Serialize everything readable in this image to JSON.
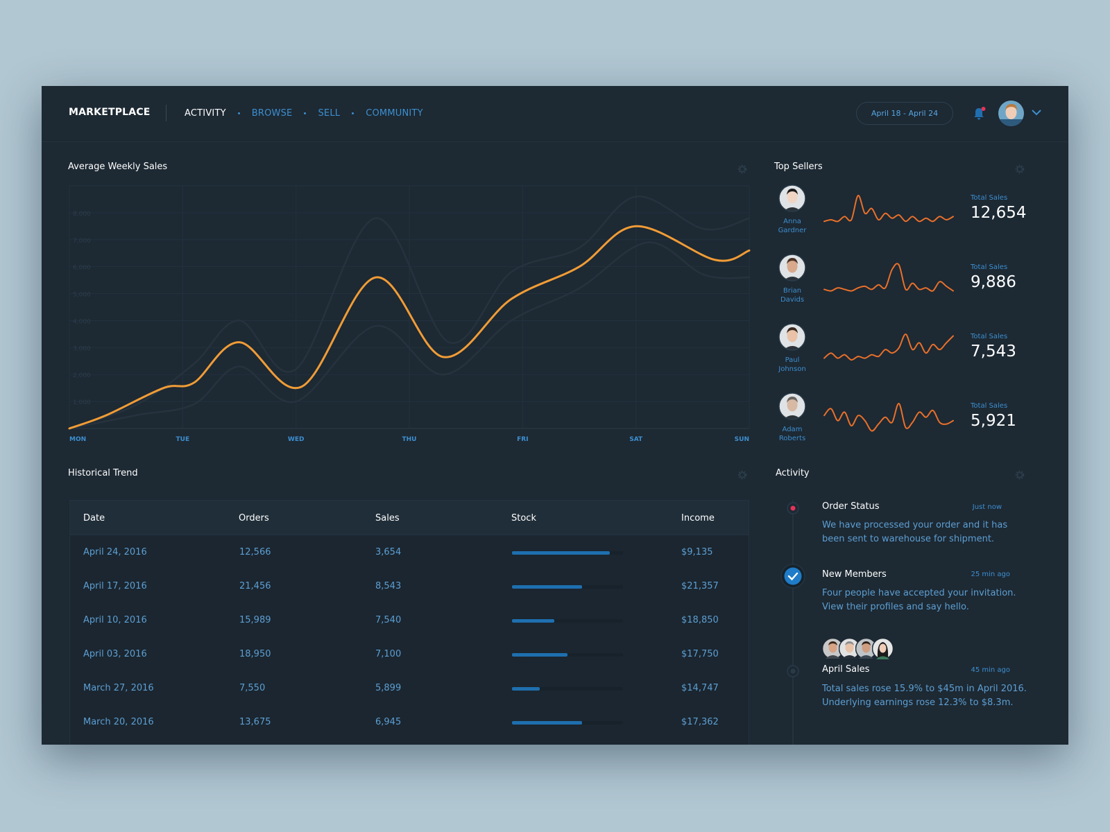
{
  "header": {
    "brand": "MARKETPLACE",
    "nav": [
      {
        "label": "ACTIVITY",
        "active": true
      },
      {
        "label": "BROWSE",
        "active": false
      },
      {
        "label": "SELL",
        "active": false
      },
      {
        "label": "COMMUNITY",
        "active": false
      }
    ],
    "date_range": "April 18 - April 24",
    "icons": {
      "notification": "bell-icon",
      "account": "chevron-down-icon"
    },
    "notification_dot_color": "#e8335a"
  },
  "sales_panel": {
    "title": "Average Weekly Sales",
    "settings_icon": "gear-icon"
  },
  "chart_data": {
    "type": "line",
    "title": "Average Weekly Sales",
    "xlabel": "",
    "ylabel": "",
    "x_ticks": [
      "MON",
      "TUE",
      "WED",
      "THU",
      "FRI",
      "SAT",
      "SUN"
    ],
    "y_ticks": [
      "1,000",
      "2,000",
      "3,000",
      "4,000",
      "5,000",
      "6,000",
      "7,000",
      "8,000"
    ],
    "ylim": [
      0,
      9000
    ],
    "grid": true,
    "series": [
      {
        "color": "#f19c36",
        "points": [
          [
            0,
            0
          ],
          [
            0.33,
            500
          ],
          [
            0.83,
            1500
          ],
          [
            1.1,
            1700
          ],
          [
            1.5,
            3200
          ],
          [
            2.05,
            1550
          ],
          [
            2.7,
            5600
          ],
          [
            3.3,
            2650
          ],
          [
            3.9,
            4800
          ],
          [
            4.5,
            6000
          ],
          [
            5.0,
            7500
          ],
          [
            5.7,
            6250
          ],
          [
            6.0,
            6600
          ]
        ]
      },
      {
        "color": "#26333e",
        "points": [
          [
            0,
            0
          ],
          [
            0.6,
            900
          ],
          [
            1.1,
            2400
          ],
          [
            1.5,
            4000
          ],
          [
            2.0,
            2200
          ],
          [
            2.7,
            7800
          ],
          [
            3.35,
            3200
          ],
          [
            3.9,
            5800
          ],
          [
            4.5,
            6700
          ],
          [
            5.0,
            8600
          ],
          [
            5.6,
            7400
          ],
          [
            6.0,
            7800
          ]
        ]
      },
      {
        "color": "#26333e",
        "points": [
          [
            0,
            0
          ],
          [
            0.6,
            500
          ],
          [
            1.1,
            900
          ],
          [
            1.5,
            2300
          ],
          [
            2.0,
            1000
          ],
          [
            2.7,
            3800
          ],
          [
            3.3,
            2000
          ],
          [
            3.9,
            4000
          ],
          [
            4.5,
            5200
          ],
          [
            5.1,
            6900
          ],
          [
            5.6,
            5700
          ],
          [
            6.0,
            5600
          ]
        ]
      }
    ]
  },
  "sellers_panel": {
    "title": "Top Sellers",
    "settings_icon": "gear-icon",
    "total_label": "Total Sales",
    "sellers": [
      {
        "first": "Anna",
        "last": "Gardner",
        "total": "12,654",
        "spark": [
          2,
          3,
          2,
          5,
          3,
          18,
          7,
          10,
          3,
          7,
          4,
          6,
          2,
          5,
          2,
          4,
          2,
          5,
          3,
          5
        ],
        "avatar_hair": "#1b1b1b",
        "avatar_skin": "#f1d5c4"
      },
      {
        "first": "Brian",
        "last": "Davids",
        "total": "9,886",
        "spark": [
          3,
          2,
          4,
          3,
          2,
          4,
          5,
          3,
          6,
          4,
          16,
          19,
          3,
          7,
          3,
          4,
          2,
          8,
          5,
          2
        ],
        "avatar_hair": "#4a3325",
        "avatar_skin": "#d9a98c"
      },
      {
        "first": "Paul",
        "last": "Johnson",
        "total": "7,543",
        "spark": [
          3,
          6,
          3,
          5,
          2,
          4,
          3,
          5,
          4,
          8,
          6,
          9,
          17,
          8,
          12,
          6,
          11,
          8,
          12,
          16
        ],
        "avatar_hair": "#3b2a20",
        "avatar_skin": "#e9c2a8"
      },
      {
        "first": "Adam",
        "last": "Roberts",
        "total": "5,921",
        "spark": [
          10,
          14,
          7,
          12,
          4,
          10,
          7,
          1,
          5,
          9,
          6,
          17,
          3,
          6,
          12,
          9,
          13,
          6,
          5,
          7
        ],
        "avatar_hair": "#6b6560",
        "avatar_skin": "#d8b9a4"
      }
    ]
  },
  "trend_panel": {
    "title": "Historical Trend",
    "settings_icon": "gear-icon",
    "columns": [
      "Date",
      "Orders",
      "Sales",
      "Stock",
      "Income"
    ],
    "rows": [
      {
        "date": "April 24, 2016",
        "orders": "12,566",
        "sales": "3,654",
        "stock": 0.88,
        "income": "$9,135"
      },
      {
        "date": "April 17, 2016",
        "orders": "21,456",
        "sales": "8,543",
        "stock": 0.63,
        "income": "$21,357"
      },
      {
        "date": "April 10, 2016",
        "orders": "15,989",
        "sales": "7,540",
        "stock": 0.38,
        "income": "$18,850"
      },
      {
        "date": "April 03, 2016",
        "orders": "18,950",
        "sales": "7,100",
        "stock": 0.5,
        "income": "$17,750"
      },
      {
        "date": "March 27, 2016",
        "orders": "7,550",
        "sales": "5,899",
        "stock": 0.25,
        "income": "$14,747"
      },
      {
        "date": "March 20, 2016",
        "orders": "13,675",
        "sales": "6,945",
        "stock": 0.63,
        "income": "$17,362"
      }
    ]
  },
  "activity_panel": {
    "title": "Activity",
    "settings_icon": "gear-icon",
    "items": [
      {
        "title": "Order Status",
        "time": "Just now",
        "body": "We have processed your order and it has been sent to warehouse for shipment.",
        "marker": "red-dot"
      },
      {
        "title": "New Members",
        "time": "25 min ago",
        "body": "Four people have accepted your invitation. View their profiles and say hello.",
        "marker": "check-icon"
      },
      {
        "title": "April Sales",
        "time": "45 min ago",
        "body": "Total sales rose 15.9% to $45m in April 2016. Underlying earnings rose 12.3% to $8.3m.",
        "marker": "hollow-dot"
      }
    ]
  },
  "colors": {
    "accent_blue": "#3d8fd0",
    "accent_orange": "#f19c36",
    "spark_orange": "#e9702a",
    "panel_bg": "#1d2933",
    "page_bg": "#b1c7d2"
  }
}
